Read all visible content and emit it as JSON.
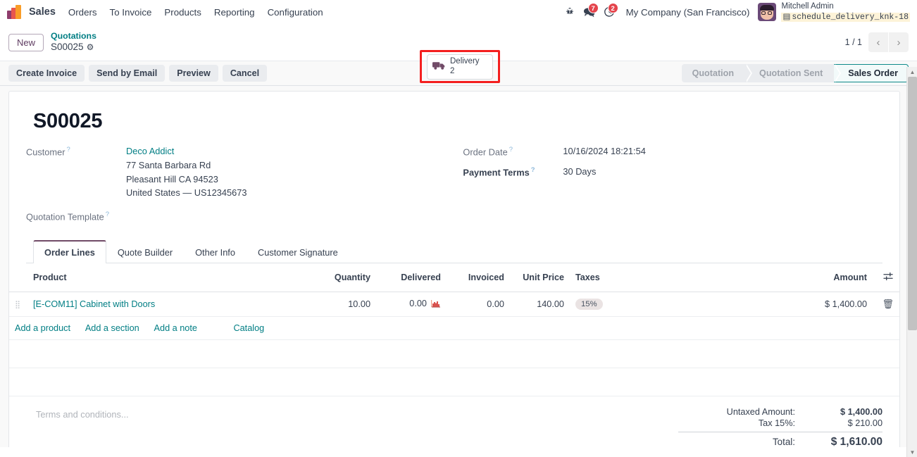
{
  "navbar": {
    "logo_icon": "odoo-sales-logo",
    "app_name": "Sales",
    "menu_items": [
      {
        "label": "Orders",
        "name": "nav-menu-orders"
      },
      {
        "label": "To Invoice",
        "name": "nav-menu-to-invoice"
      },
      {
        "label": "Products",
        "name": "nav-menu-products"
      },
      {
        "label": "Reporting",
        "name": "nav-menu-reporting"
      },
      {
        "label": "Configuration",
        "name": "nav-menu-configuration"
      }
    ],
    "bug_icon": "bug-icon",
    "messages_icon": "messages-icon",
    "messages_count": "7",
    "activities_icon": "clock-icon",
    "activities_count": "2",
    "company": "My Company (San Francisco)",
    "user_name": "Mitchell Admin",
    "user_branch": "schedule_delivery_knk-18",
    "branch_icon": "database-icon",
    "avatar": "user-avatar"
  },
  "control_panel": {
    "new_button": "New",
    "breadcrumb_parent": "Quotations",
    "breadcrumb_current": "S00025",
    "gear_icon": "gear-icon",
    "smart_button": {
      "icon": "truck-icon",
      "label": "Delivery",
      "value": "2"
    },
    "pager": {
      "count": "1 / 1",
      "prev_icon": "chevron-left-icon",
      "next_icon": "chevron-right-icon"
    }
  },
  "actions": {
    "buttons": [
      {
        "label": "Create Invoice",
        "name": "create-invoice-button"
      },
      {
        "label": "Send by Email",
        "name": "send-by-email-button"
      },
      {
        "label": "Preview",
        "name": "preview-button"
      },
      {
        "label": "Cancel",
        "name": "cancel-button"
      }
    ]
  },
  "statusbar": {
    "stages": [
      {
        "label": "Quotation",
        "active": false
      },
      {
        "label": "Quotation Sent",
        "active": false
      },
      {
        "label": "Sales Order",
        "active": true
      }
    ],
    "active_color": "#0e8a8a"
  },
  "form": {
    "title": "S00025",
    "customer_label": "Customer",
    "customer_name": "Deco Addict",
    "customer_street": "77 Santa Barbara Rd",
    "customer_city": "Pleasant Hill CA 94523",
    "customer_country": "United States — US12345673",
    "quotation_template_label": "Quotation Template",
    "quotation_template_value": "",
    "order_date_label": "Order Date",
    "order_date_value": "10/16/2024 18:21:54",
    "payment_terms_label": "Payment Terms",
    "payment_terms_value": "30 Days"
  },
  "notebook": {
    "tabs": [
      {
        "label": "Order Lines",
        "active": true
      },
      {
        "label": "Quote Builder",
        "active": false
      },
      {
        "label": "Other Info",
        "active": false
      },
      {
        "label": "Customer Signature",
        "active": false
      }
    ]
  },
  "order_lines": {
    "columns": {
      "product": "Product",
      "quantity": "Quantity",
      "delivered": "Delivered",
      "invoiced": "Invoiced",
      "unit_price": "Unit Price",
      "taxes": "Taxes",
      "amount": "Amount"
    },
    "optional_columns_icon": "sliders-icon",
    "rows": [
      {
        "drag_icon": "drag-handle-icon",
        "product": "[E-COM11] Cabinet with Doors",
        "quantity": "10.00",
        "delivered": "0.00",
        "delivered_icon": "forecast-chart-icon",
        "invoiced": "0.00",
        "unit_price": "140.00",
        "tax": "15%",
        "amount": "$ 1,400.00",
        "delete_icon": "trash-icon"
      }
    ],
    "add_links": [
      {
        "label": "Add a product",
        "name": "add-a-product-link"
      },
      {
        "label": "Add a section",
        "name": "add-a-section-link"
      },
      {
        "label": "Add a note",
        "name": "add-a-note-link"
      },
      {
        "label": "Catalog",
        "name": "catalog-link"
      }
    ]
  },
  "footer": {
    "terms_placeholder": "Terms and conditions...",
    "untaxed_label": "Untaxed Amount:",
    "untaxed_value": "$ 1,400.00",
    "tax_label": "Tax 15%:",
    "tax_value": "$ 210.00",
    "total_label": "Total:",
    "total_value": "$ 1,610.00"
  }
}
